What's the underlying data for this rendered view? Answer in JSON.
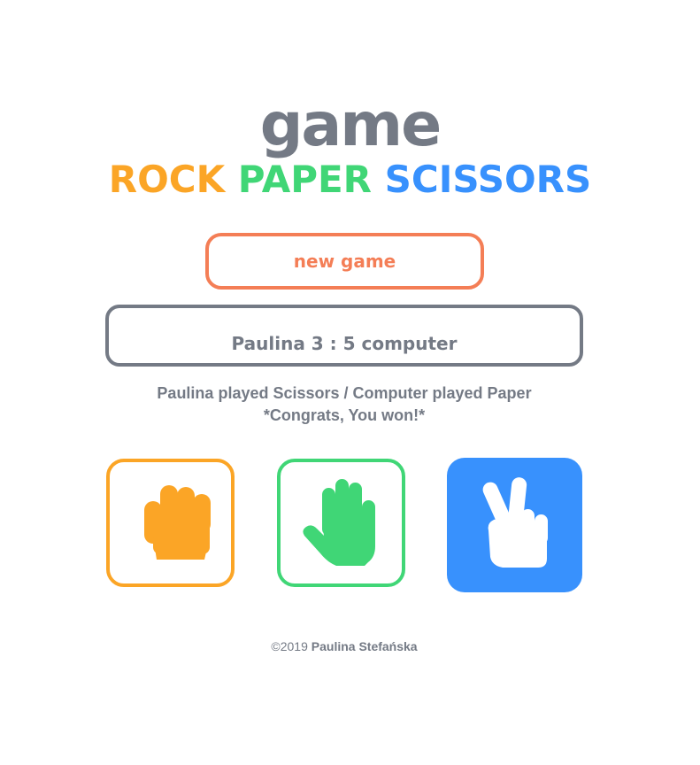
{
  "header": {
    "title": "game",
    "subtitle_rock": "ROCK",
    "subtitle_paper": "PAPER",
    "subtitle_scissors": "SCISSORS"
  },
  "controls": {
    "new_game_label": "new game"
  },
  "score": {
    "text": "Paulina 3 : 5 computer",
    "player_name": "Paulina",
    "player_score": 3,
    "computer_score": 5
  },
  "result": {
    "line1": "Paulina played Scissors / Computer played Paper",
    "line2": "*Congrats, You won!*"
  },
  "choices": [
    {
      "name": "rock",
      "icon": "fist-icon",
      "color": "#fba526",
      "selected": false
    },
    {
      "name": "paper",
      "icon": "open-hand-icon",
      "color": "#40d676",
      "selected": false
    },
    {
      "name": "scissors",
      "icon": "victory-hand-icon",
      "color": "#3891fd",
      "selected": true
    }
  ],
  "footer": {
    "copyright": "©2019",
    "author": "Paulina Stefańska"
  },
  "colors": {
    "text_gray": "#747a85",
    "accent_orange_red": "#f47e56",
    "rock": "#fba526",
    "paper": "#40d676",
    "scissors": "#3891fd"
  }
}
